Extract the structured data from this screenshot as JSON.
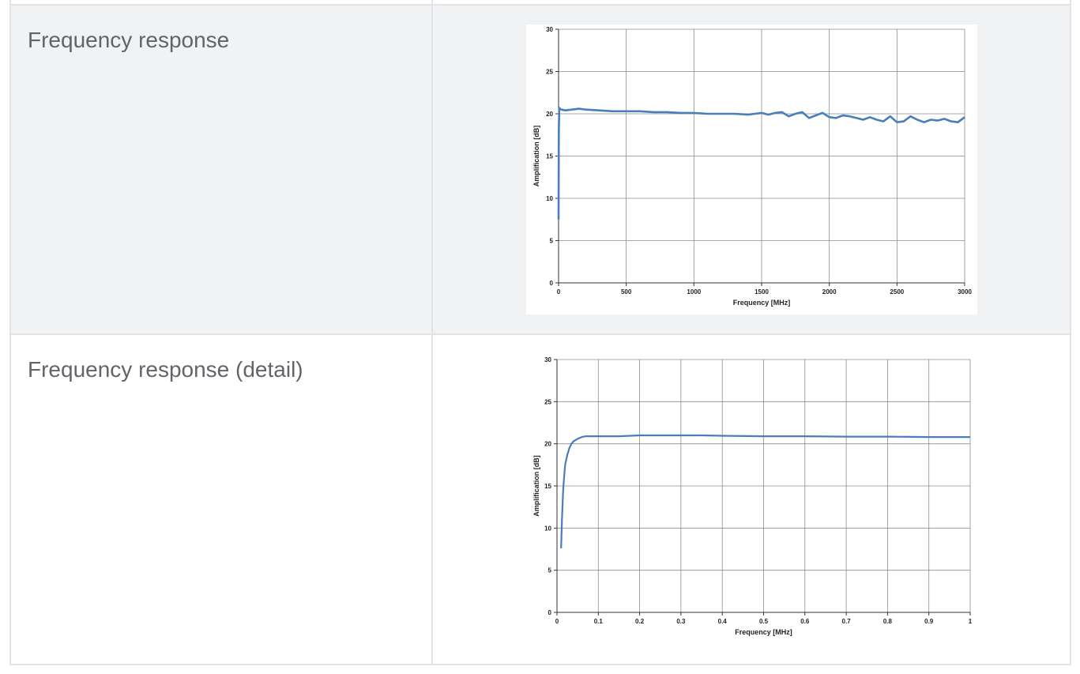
{
  "table": {
    "rows": [
      {
        "label": "Frequency response"
      },
      {
        "label": "Frequency response (detail)"
      }
    ]
  },
  "colors": {
    "series": "#4a7ebb",
    "grid": "#8c8c8c",
    "row_alt": "#f1f2f4",
    "border": "#e1e3e6"
  },
  "chart_data": [
    {
      "type": "line",
      "title": "",
      "xlabel": "Frequency [MHz]",
      "ylabel": "Amplification [dB]",
      "xlim": [
        0,
        3000
      ],
      "ylim": [
        0,
        30
      ],
      "xticks": [
        0,
        500,
        1000,
        1500,
        2000,
        2500,
        3000
      ],
      "yticks": [
        0,
        5,
        10,
        15,
        20,
        25,
        30
      ],
      "xtick_labels": [
        "0",
        "500",
        "1000",
        "1500",
        "2000",
        "2500",
        "3000"
      ],
      "ytick_labels": [
        "0",
        "5",
        "10",
        "15",
        "20",
        "25",
        "30"
      ],
      "grid": true,
      "series": [
        {
          "color": "#4a7ebb",
          "x": [
            0,
            2,
            5,
            10,
            20,
            50,
            100,
            150,
            200,
            300,
            400,
            500,
            600,
            700,
            800,
            900,
            1000,
            1100,
            1200,
            1300,
            1400,
            1450,
            1500,
            1550,
            1600,
            1650,
            1700,
            1750,
            1800,
            1850,
            1900,
            1950,
            2000,
            2050,
            2100,
            2150,
            2200,
            2250,
            2300,
            2350,
            2400,
            2450,
            2500,
            2550,
            2600,
            2650,
            2700,
            2750,
            2800,
            2850,
            2900,
            2950,
            3000
          ],
          "y": [
            7.5,
            18,
            20.7,
            20.6,
            20.5,
            20.4,
            20.5,
            20.6,
            20.5,
            20.4,
            20.3,
            20.3,
            20.3,
            20.2,
            20.2,
            20.1,
            20.1,
            20.0,
            20.0,
            20.0,
            19.9,
            20.0,
            20.1,
            19.9,
            20.1,
            20.2,
            19.7,
            20.0,
            20.2,
            19.5,
            19.8,
            20.1,
            19.6,
            19.5,
            19.8,
            19.7,
            19.5,
            19.3,
            19.6,
            19.3,
            19.1,
            19.7,
            19.0,
            19.1,
            19.7,
            19.3,
            19.0,
            19.3,
            19.2,
            19.4,
            19.1,
            19.0,
            19.6
          ]
        }
      ]
    },
    {
      "type": "line",
      "title": "",
      "xlabel": "Frequency [MHz]",
      "ylabel": "Amplification [dB]",
      "xlim": [
        0,
        1
      ],
      "ylim": [
        0,
        30
      ],
      "xticks": [
        0,
        0.1,
        0.2,
        0.3,
        0.4,
        0.5,
        0.6,
        0.7,
        0.8,
        0.9,
        1
      ],
      "yticks": [
        0,
        5,
        10,
        15,
        20,
        25,
        30
      ],
      "xtick_labels": [
        "0",
        "0.1",
        "0.2",
        "0.3",
        "0.4",
        "0.5",
        "0.6",
        "0.7",
        "0.8",
        "0.9",
        "1"
      ],
      "ytick_labels": [
        "0",
        "5",
        "10",
        "15",
        "20",
        "25",
        "30"
      ],
      "grid": true,
      "series": [
        {
          "color": "#4a7ebb",
          "x": [
            0.01,
            0.012,
            0.015,
            0.018,
            0.02,
            0.025,
            0.03,
            0.035,
            0.04,
            0.05,
            0.06,
            0.07,
            0.08,
            0.1,
            0.15,
            0.2,
            0.25,
            0.3,
            0.35,
            0.4,
            0.5,
            0.6,
            0.7,
            0.8,
            0.9,
            1.0
          ],
          "y": [
            7.6,
            11.0,
            14.5,
            16.5,
            17.6,
            18.7,
            19.5,
            20.0,
            20.3,
            20.6,
            20.8,
            20.9,
            20.9,
            20.9,
            20.9,
            21.0,
            21.0,
            21.0,
            21.0,
            20.95,
            20.9,
            20.9,
            20.85,
            20.85,
            20.8,
            20.8
          ]
        }
      ]
    }
  ]
}
